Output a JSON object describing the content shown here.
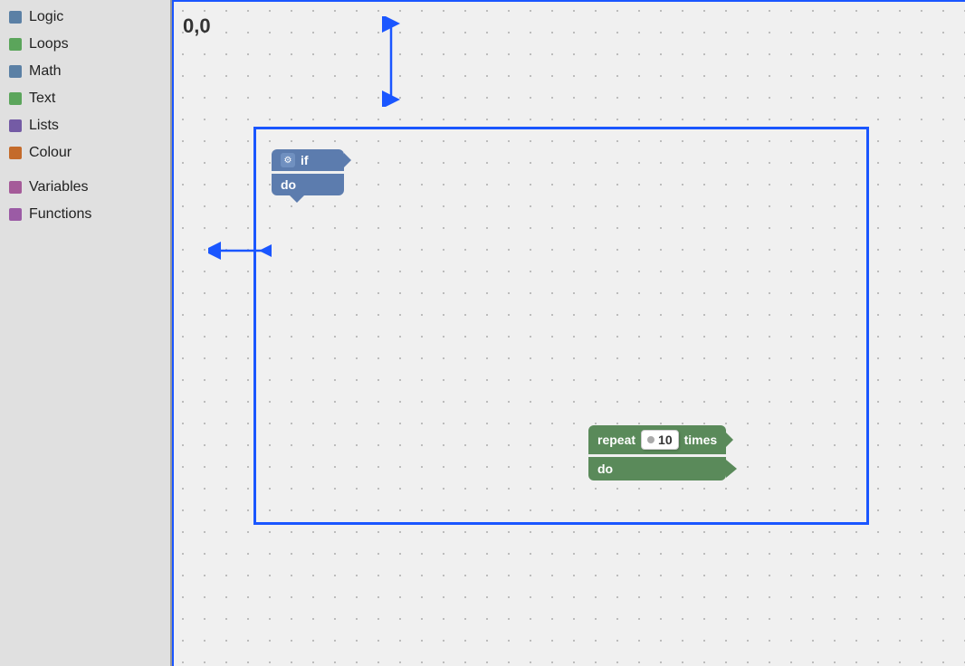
{
  "sidebar": {
    "items": [
      {
        "label": "Logic",
        "color": "#5b80a5"
      },
      {
        "label": "Loops",
        "color": "#5ba55b"
      },
      {
        "label": "Math",
        "color": "#5b80a5"
      },
      {
        "label": "Text",
        "color": "#5ba55b"
      },
      {
        "label": "Lists",
        "color": "#745ba5"
      },
      {
        "label": "Colour",
        "color": "#a55b5b"
      },
      {
        "label": "Variables",
        "color": "#a55b99"
      },
      {
        "label": "Functions",
        "color": "#9b5ba5"
      }
    ]
  },
  "canvas": {
    "coord": "0,0",
    "if_block": {
      "top_label": "if",
      "bottom_label": "do"
    },
    "repeat_block": {
      "repeat_label": "repeat",
      "value": "10",
      "times_label": "times",
      "do_label": "do"
    }
  }
}
